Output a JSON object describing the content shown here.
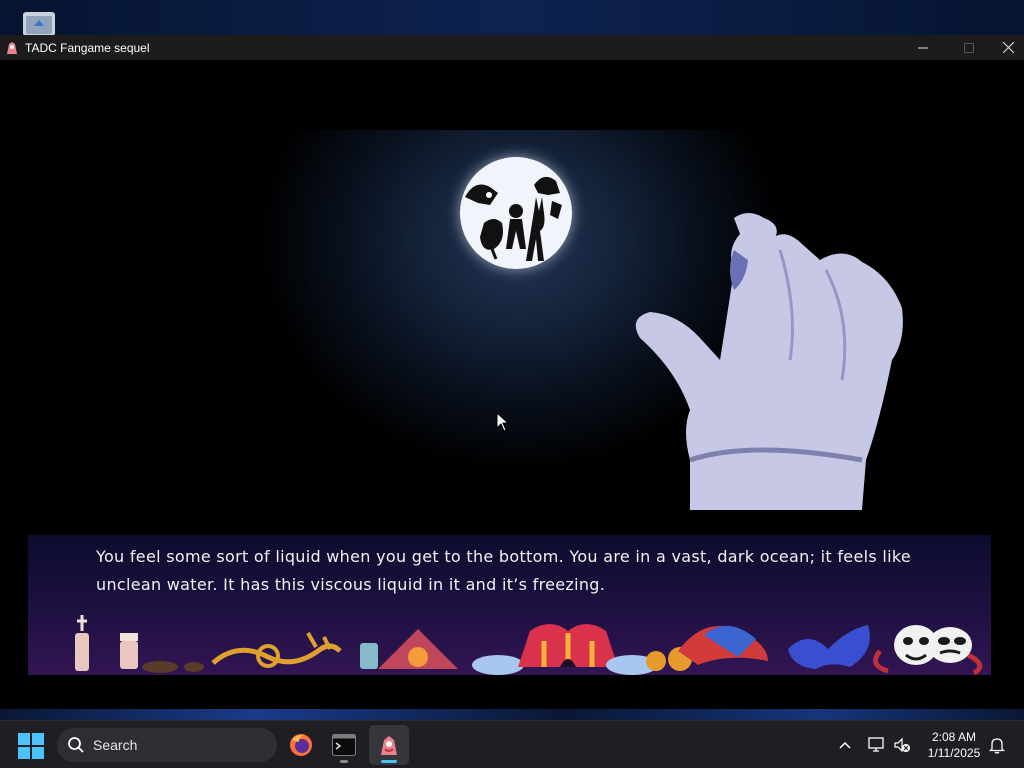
{
  "window": {
    "title": "TADC Fangame sequel"
  },
  "game": {
    "dialog_text": "You feel some sort of liquid when you get to the bottom. You are in a vast, dark ocean; it feels like unclean water. It has this viscous liquid in it and it’s freezing."
  },
  "taskbar": {
    "search_placeholder": "Search",
    "time": "2:08 AM",
    "date": "1/11/2025",
    "apps": [
      "firefox-icon",
      "terminal-icon",
      "tadc-game-icon"
    ]
  },
  "colors": {
    "accent": "#4cc2ff",
    "taskbar_bg": "#1f1f23",
    "titlebar_bg": "#1c1c1c"
  }
}
